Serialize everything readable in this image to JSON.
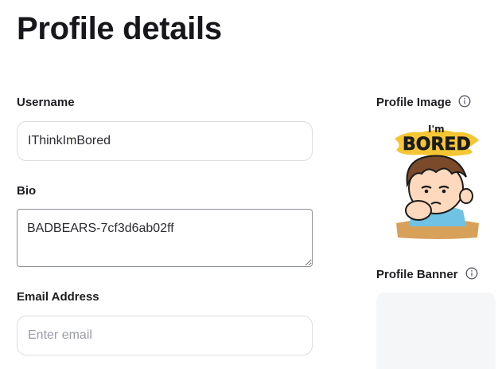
{
  "page": {
    "title": "Profile details"
  },
  "form": {
    "username_label": "Username",
    "username_value": "IThinkImBored",
    "bio_label": "Bio",
    "bio_value": "BADBEARS-7cf3d6ab02ff",
    "email_label": "Email Address",
    "email_value": "",
    "email_placeholder": "Enter email"
  },
  "side": {
    "profile_image_label": "Profile Image",
    "profile_banner_label": "Profile Banner",
    "sticker_text_top": "I'm",
    "sticker_text_main": "BORED"
  },
  "icons": {
    "info": "info-circle-icon"
  },
  "colors": {
    "input_border": "#dcdde2",
    "banner_bg": "#f5f6f8",
    "sticker_yellow": "#f5c634"
  }
}
